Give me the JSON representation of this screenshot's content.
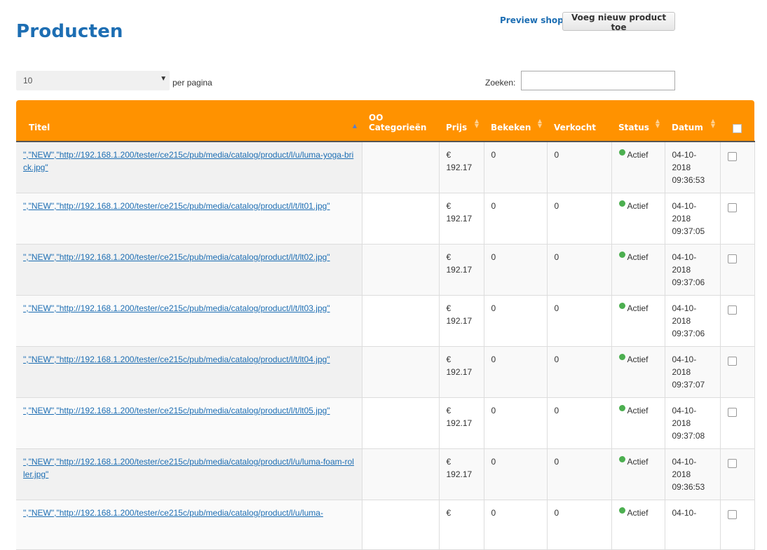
{
  "header": {
    "title": "Producten",
    "preview_label": "Preview shop",
    "add_label": "Voeg nieuw product toe"
  },
  "controls": {
    "per_page_value": "10",
    "per_page_label": "per pagina",
    "search_label": "Zoeken:",
    "search_value": ""
  },
  "table": {
    "columns": {
      "title": "Titel",
      "categories_1": "OO",
      "categories_2": "Categorieën",
      "price": "Prijs",
      "viewed": "Bekeken",
      "sold": "Verkocht",
      "status": "Status",
      "date": "Datum"
    },
    "rows": [
      {
        "title": "\",\"NEW\",\"http://192.168.1.200/tester/ce215c/pub/media/catalog/product/l/u/luma-yoga-brick.jpg\"",
        "categories": "",
        "currency": "€",
        "price": "192.17",
        "viewed": "0",
        "sold": "0",
        "status": "Actief",
        "date": "04-10-2018",
        "time": "09:36:53"
      },
      {
        "title": "\",\"NEW\",\"http://192.168.1.200/tester/ce215c/pub/media/catalog/product/l/t/lt01.jpg\"",
        "categories": "",
        "currency": "€",
        "price": "192.17",
        "viewed": "0",
        "sold": "0",
        "status": "Actief",
        "date": "04-10-2018",
        "time": "09:37:05"
      },
      {
        "title": "\",\"NEW\",\"http://192.168.1.200/tester/ce215c/pub/media/catalog/product/l/t/lt02.jpg\"",
        "categories": "",
        "currency": "€",
        "price": "192.17",
        "viewed": "0",
        "sold": "0",
        "status": "Actief",
        "date": "04-10-2018",
        "time": "09:37:06"
      },
      {
        "title": "\",\"NEW\",\"http://192.168.1.200/tester/ce215c/pub/media/catalog/product/l/t/lt03.jpg\"",
        "categories": "",
        "currency": "€",
        "price": "192.17",
        "viewed": "0",
        "sold": "0",
        "status": "Actief",
        "date": "04-10-2018",
        "time": "09:37:06"
      },
      {
        "title": "\",\"NEW\",\"http://192.168.1.200/tester/ce215c/pub/media/catalog/product/l/t/lt04.jpg\"",
        "categories": "",
        "currency": "€",
        "price": "192.17",
        "viewed": "0",
        "sold": "0",
        "status": "Actief",
        "date": "04-10-2018",
        "time": "09:37:07"
      },
      {
        "title": "\",\"NEW\",\"http://192.168.1.200/tester/ce215c/pub/media/catalog/product/l/t/lt05.jpg\"",
        "categories": "",
        "currency": "€",
        "price": "192.17",
        "viewed": "0",
        "sold": "0",
        "status": "Actief",
        "date": "04-10-2018",
        "time": "09:37:08"
      },
      {
        "title": "\",\"NEW\",\"http://192.168.1.200/tester/ce215c/pub/media/catalog/product/l/u/luma-foam-roller.jpg\"",
        "categories": "",
        "currency": "€",
        "price": "192.17",
        "viewed": "0",
        "sold": "0",
        "status": "Actief",
        "date": "04-10-2018",
        "time": "09:36:53"
      },
      {
        "title": "\",\"NEW\",\"http://192.168.1.200/tester/ce215c/pub/media/catalog/product/l/u/luma-",
        "categories": "",
        "currency": "€",
        "price": "",
        "viewed": "0",
        "sold": "0",
        "status": "Actief",
        "date": "04-10-",
        "time": ""
      }
    ]
  },
  "colors": {
    "header_orange": "#ff9200",
    "title_blue": "#1d6eb3",
    "status_green": "#4caf50"
  },
  "icons": {
    "sort": "sort-arrows-icon",
    "status": "status-dot-icon",
    "caret": "chevron-down-icon"
  }
}
